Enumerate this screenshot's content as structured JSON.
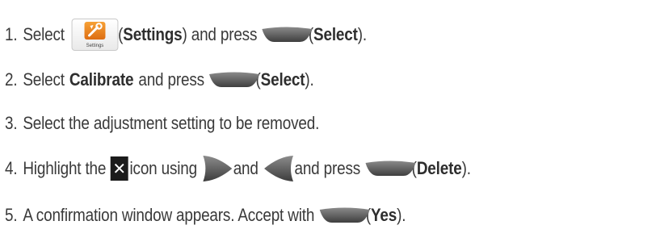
{
  "steps": [
    {
      "number": "1.",
      "parts": {
        "a": "Select",
        "b": "(",
        "c": "Settings",
        "d": ") and press",
        "e": "(",
        "f": "Select",
        "g": ")."
      }
    },
    {
      "number": "2.",
      "parts": {
        "a": "Select",
        "b": "Calibrate",
        "c": "and press",
        "d": "(",
        "e": "Select",
        "f": ")."
      }
    },
    {
      "number": "3.",
      "parts": {
        "a": "Select the adjustment setting to be removed."
      }
    },
    {
      "number": "4.",
      "parts": {
        "a": "Highlight the",
        "b": "icon using",
        "c": "and",
        "d": "and press",
        "e": "(",
        "f": "Delete",
        "g": ")."
      }
    },
    {
      "number": "5.",
      "parts": {
        "a": "A confirmation window appears. Accept with",
        "b": "(",
        "c": "Yes",
        "d": ")."
      }
    }
  ],
  "icons": {
    "settings_caption": "Settings",
    "softkey_color": "#5a5a5a",
    "settings_tile_color": "#e8861f",
    "x_glyph": "✕"
  }
}
